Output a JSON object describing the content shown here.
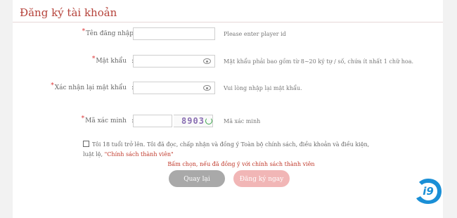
{
  "header": {
    "title": "Đăng ký tài khoản"
  },
  "form": {
    "username": {
      "label": "Tên đăng nhập",
      "value": "",
      "hint": "Please enter player id"
    },
    "password": {
      "label": "Mật khẩu",
      "value": "",
      "hint": "Mật khẩu phải bao gồm từ 8~20 ký tự / số, chứa ít nhất 1 chữ hoa."
    },
    "confirm": {
      "label": "Xác nhận lại mật khẩu",
      "value": "",
      "hint": "Vui lòng nhập lại mật khẩu."
    },
    "captcha": {
      "label": "Mã xác minh",
      "value": "",
      "code": "8903",
      "hint": "Mã xác minh"
    },
    "agreement": {
      "text": "Tôi 18 tuổi trở lên. Tôi đã đọc, chấp nhận và đồng ý Toàn bộ chính sách, điều khoản và điều kiện, luật lệ,",
      "policy_link": "\"Chính sách thành viên\"",
      "warning": "Bấm chọn, nếu đã đồng ý với chính sách thành viên"
    },
    "colon": ":",
    "required_mark": "*"
  },
  "buttons": {
    "back": "Quay lại",
    "submit": "Đăng ký ngay"
  },
  "brand": {
    "logo_text": "i9"
  },
  "colors": {
    "accent": "#b5423a",
    "logo_blue": "#1a8fd6"
  }
}
